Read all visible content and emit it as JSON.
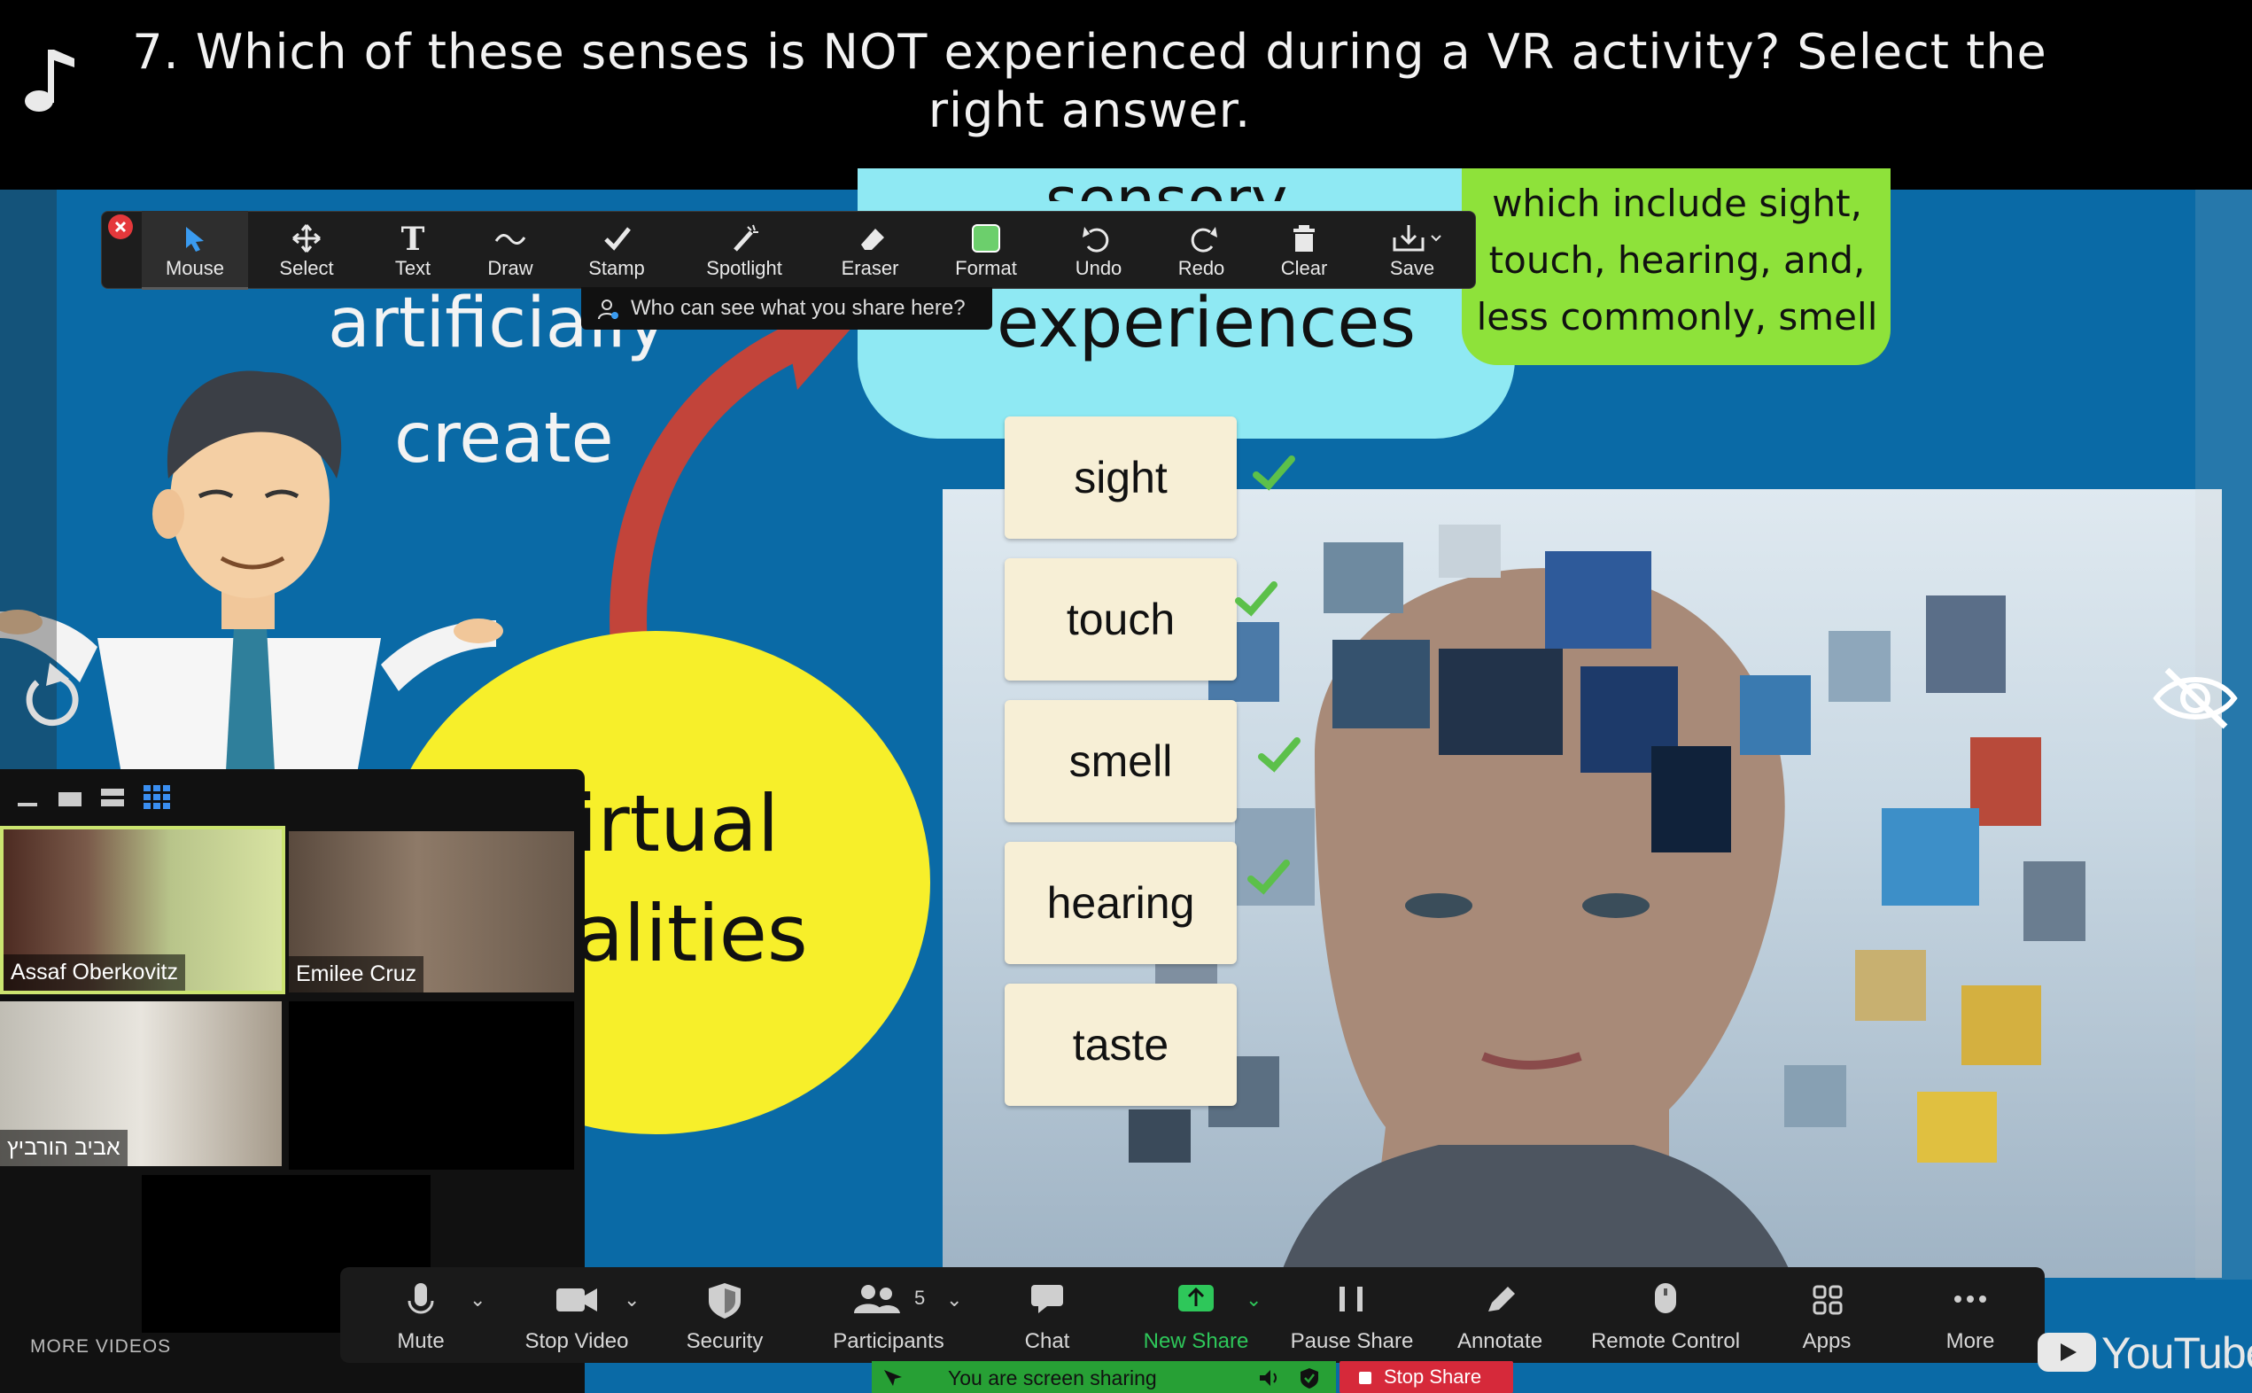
{
  "question": {
    "text": "7. Which of these senses is NOT experienced during a VR activity? Select the right answer."
  },
  "slide": {
    "artificially": "artificially",
    "create": "create",
    "sensory": "sensory",
    "experiences": "experiences",
    "green_box": "which include sight, touch, hearing, and, less commonly, smell",
    "virtual": "irtual",
    "realities": "alities"
  },
  "answers": [
    {
      "label": "sight",
      "checked": true
    },
    {
      "label": "touch",
      "checked": true
    },
    {
      "label": "smell",
      "checked": true
    },
    {
      "label": "hearing",
      "checked": true
    },
    {
      "label": "taste",
      "checked": false
    }
  ],
  "annotation_toolbar": {
    "tools": [
      {
        "label": "Mouse",
        "icon": "arrow-cursor-icon"
      },
      {
        "label": "Select",
        "icon": "move-icon"
      },
      {
        "label": "Text",
        "icon": "text-icon"
      },
      {
        "label": "Draw",
        "icon": "squiggle-icon"
      },
      {
        "label": "Stamp",
        "icon": "checkmark-icon"
      },
      {
        "label": "Spotlight",
        "icon": "magic-wand-icon"
      },
      {
        "label": "Eraser",
        "icon": "eraser-icon"
      },
      {
        "label": "Format",
        "icon": "color-swatch-icon"
      },
      {
        "label": "Undo",
        "icon": "undo-icon"
      },
      {
        "label": "Redo",
        "icon": "redo-icon"
      },
      {
        "label": "Clear",
        "icon": "trash-icon"
      },
      {
        "label": "Save",
        "icon": "save-icon"
      }
    ],
    "format_color": "#6ccf6c",
    "who_sees": "Who can see what you share here?"
  },
  "gallery": {
    "participants": [
      {
        "name": "Assaf Oberkovitz",
        "active_speaker": true
      },
      {
        "name": "Emilee Cruz"
      },
      {
        "name": "אביב הורביץ"
      }
    ]
  },
  "controls": {
    "mute": "Mute",
    "stop_video": "Stop Video",
    "security": "Security",
    "participants": "Participants",
    "participants_count": "5",
    "chat": "Chat",
    "new_share": "New Share",
    "pause_share": "Pause Share",
    "annotate": "Annotate",
    "remote_control": "Remote Control",
    "apps": "Apps",
    "more": "More"
  },
  "sharing": {
    "status": "You are screen sharing",
    "stop": "Stop Share"
  },
  "youtube": {
    "more_videos": "MORE VIDEOS",
    "logo": "YouTube"
  },
  "colors": {
    "accent_green": "#27a035",
    "stop_red": "#d6293a",
    "active_speaker_border": "#cbe470",
    "new_share_green": "#2ec75a",
    "check_green": "#5cc04a"
  }
}
